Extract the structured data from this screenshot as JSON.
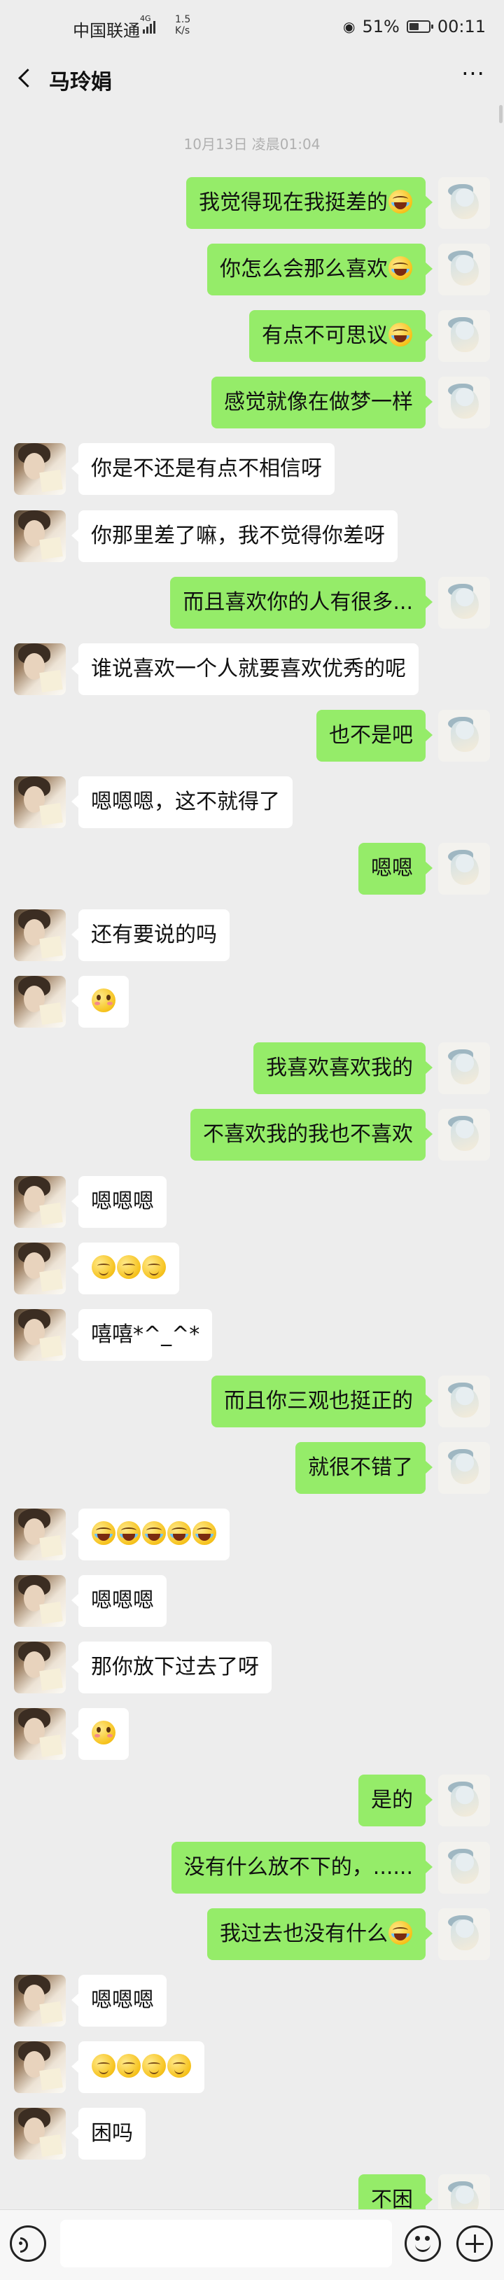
{
  "status": {
    "carrier": "中国联通",
    "network": "4G",
    "speed_value": "1.5",
    "speed_unit": "K/s",
    "battery": "51%",
    "battery_level": 0.51,
    "time": "00:11"
  },
  "header": {
    "contact_name": "马玲娟"
  },
  "chat": {
    "timestamp": "10月13日 凌晨01:04",
    "messages": [
      {
        "side": "right",
        "text": "我觉得现在我挺差的",
        "emoji": [
          "joy"
        ]
      },
      {
        "side": "right",
        "text": "你怎么会那么喜欢",
        "emoji": [
          "joy"
        ]
      },
      {
        "side": "right",
        "text": "有点不可思议",
        "emoji": [
          "joy"
        ]
      },
      {
        "side": "right",
        "text": "感觉就像在做梦一样"
      },
      {
        "side": "left",
        "text": "你是不还是有点不相信呀"
      },
      {
        "side": "left",
        "text": "你那里差了嘛，我不觉得你差呀"
      },
      {
        "side": "right",
        "text": "而且喜欢你的人有很多..."
      },
      {
        "side": "left",
        "text": "谁说喜欢一个人就要喜欢优秀的呢"
      },
      {
        "side": "right",
        "text": "也不是吧"
      },
      {
        "side": "left",
        "text": "嗯嗯嗯，这不就得了"
      },
      {
        "side": "right",
        "text": "嗯嗯"
      },
      {
        "side": "left",
        "text": "还有要说的吗"
      },
      {
        "side": "left",
        "text": "",
        "emoji": [
          "flush"
        ]
      },
      {
        "side": "right",
        "text": "我喜欢喜欢我的"
      },
      {
        "side": "right",
        "text": "不喜欢我的我也不喜欢"
      },
      {
        "side": "left",
        "text": "嗯嗯嗯"
      },
      {
        "side": "left",
        "text": "",
        "emoji": [
          "blush",
          "blush",
          "blush"
        ]
      },
      {
        "side": "left",
        "text": "嘻嘻*^_^*"
      },
      {
        "side": "right",
        "text": "而且你三观也挺正的"
      },
      {
        "side": "right",
        "text": "就很不错了"
      },
      {
        "side": "left",
        "text": "",
        "emoji": [
          "joy",
          "joy",
          "joy",
          "joy",
          "joy"
        ]
      },
      {
        "side": "left",
        "text": "嗯嗯嗯"
      },
      {
        "side": "left",
        "text": "那你放下过去了呀"
      },
      {
        "side": "left",
        "text": "",
        "emoji": [
          "flush"
        ]
      },
      {
        "side": "right",
        "text": "是的"
      },
      {
        "side": "right",
        "text": "没有什么放不下的，......"
      },
      {
        "side": "right",
        "text": "我过去也没有什么",
        "emoji": [
          "joy"
        ]
      },
      {
        "side": "left",
        "text": "嗯嗯嗯"
      },
      {
        "side": "left",
        "text": "",
        "emoji": [
          "blush",
          "blush",
          "blush",
          "blush"
        ]
      },
      {
        "side": "left",
        "text": "困吗"
      },
      {
        "side": "right",
        "text": "不困"
      }
    ]
  },
  "icons": {
    "back": "chevron-left-icon",
    "more": "more-dots-icon",
    "voice": "voice-icon",
    "emoji": "emoji-icon",
    "plus": "plus-icon"
  },
  "colors": {
    "background": "#ededed",
    "self_bubble": "#95ec69",
    "other_bubble": "#ffffff"
  }
}
